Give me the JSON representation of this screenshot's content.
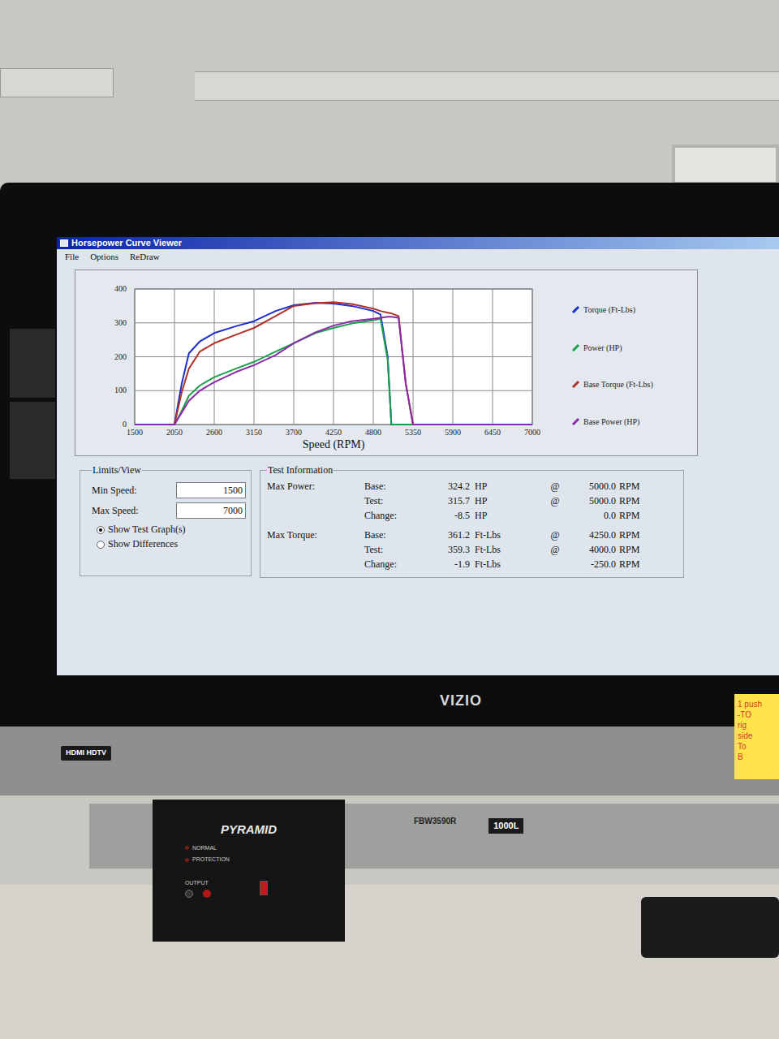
{
  "window": {
    "title": "Horsepower Curve Viewer"
  },
  "menu": [
    "File",
    "Options",
    "ReDraw"
  ],
  "chart": {
    "y_ticks": [
      "400",
      "300",
      "200",
      "100",
      "0"
    ],
    "x_ticks": [
      "1500",
      "2050",
      "2600",
      "3150",
      "3700",
      "4250",
      "4800",
      "5350",
      "5900",
      "6450",
      "7000"
    ],
    "x_title": "Speed (RPM)",
    "x_min": 1500,
    "x_max": 7000,
    "y_max": 400,
    "rpm": [
      1500,
      2050,
      2150,
      2250,
      2400,
      2600,
      2900,
      3150,
      3450,
      3700,
      4000,
      4250,
      4500,
      4800,
      4900,
      5000,
      5050,
      5150,
      5250,
      5350,
      7000
    ],
    "series": [
      {
        "label": "Torque (Ft-Lbs)",
        "color": "#1a2fcf",
        "values": [
          0,
          0,
          120,
          210,
          245,
          270,
          290,
          305,
          335,
          352,
          359,
          357,
          350,
          335,
          325,
          200,
          0,
          0,
          0,
          0,
          0
        ]
      },
      {
        "label": "Power (HP)",
        "color": "#1aa04a",
        "values": [
          0,
          0,
          40,
          85,
          115,
          140,
          165,
          185,
          215,
          240,
          270,
          285,
          298,
          308,
          312,
          190,
          0,
          0,
          0,
          0,
          0
        ]
      },
      {
        "label": "Base Torque (Ft-Lbs)",
        "color": "#b0302a",
        "values": [
          0,
          0,
          95,
          165,
          215,
          240,
          265,
          285,
          320,
          350,
          358,
          361,
          356,
          342,
          335,
          330,
          328,
          320,
          120,
          0,
          0
        ]
      },
      {
        "label": "Base Power (HP)",
        "color": "#8a2aa8",
        "values": [
          0,
          0,
          35,
          70,
          100,
          125,
          155,
          175,
          205,
          240,
          272,
          292,
          305,
          312,
          315,
          318,
          318,
          315,
          120,
          0,
          0
        ]
      }
    ]
  },
  "limits": {
    "title": "Limits/View",
    "fields": [
      {
        "label": "Min Speed:",
        "value": "1500"
      },
      {
        "label": "Max Speed:",
        "value": "7000"
      }
    ],
    "options": [
      {
        "label": "Show Test Graph(s)",
        "selected": true
      },
      {
        "label": "Show Differences",
        "selected": false
      }
    ]
  },
  "test_info": {
    "title": "Test Information",
    "sections": [
      {
        "label": "Max Power:",
        "rows": [
          {
            "name": "Base:",
            "value": "324.2",
            "unit": "HP",
            "at": "@",
            "rpm": "5000.0",
            "rpm_unit": "RPM"
          },
          {
            "name": "Test:",
            "value": "315.7",
            "unit": "HP",
            "at": "@",
            "rpm": "5000.0",
            "rpm_unit": "RPM"
          },
          {
            "name": "Change:",
            "value": "-8.5",
            "unit": "HP",
            "at": "",
            "rpm": "0.0",
            "rpm_unit": "RPM"
          }
        ]
      },
      {
        "label": "Max Torque:",
        "rows": [
          {
            "name": "Base:",
            "value": "361.2",
            "unit": "Ft-Lbs",
            "at": "@",
            "rpm": "4250.0",
            "rpm_unit": "RPM"
          },
          {
            "name": "Test:",
            "value": "359.3",
            "unit": "Ft-Lbs",
            "at": "@",
            "rpm": "4000.0",
            "rpm_unit": "RPM"
          },
          {
            "name": "Change:",
            "value": "-1.9",
            "unit": "Ft-Lbs",
            "at": "",
            "rpm": "-250.0",
            "rpm_unit": "RPM"
          }
        ]
      }
    ]
  },
  "monitor": {
    "brand": "VIZIO",
    "badge": "HDMI HDTV"
  },
  "power_supply": {
    "brand": "PYRAMID",
    "lights": [
      "NORMAL",
      "PROTECTION"
    ],
    "output": "OUTPUT"
  },
  "rail": {
    "model": "FBW3590R",
    "length": "1000L"
  },
  "sticky_note": {
    "lines": [
      "1 push",
      "-TO",
      "rig",
      "side",
      "To",
      "B"
    ]
  }
}
